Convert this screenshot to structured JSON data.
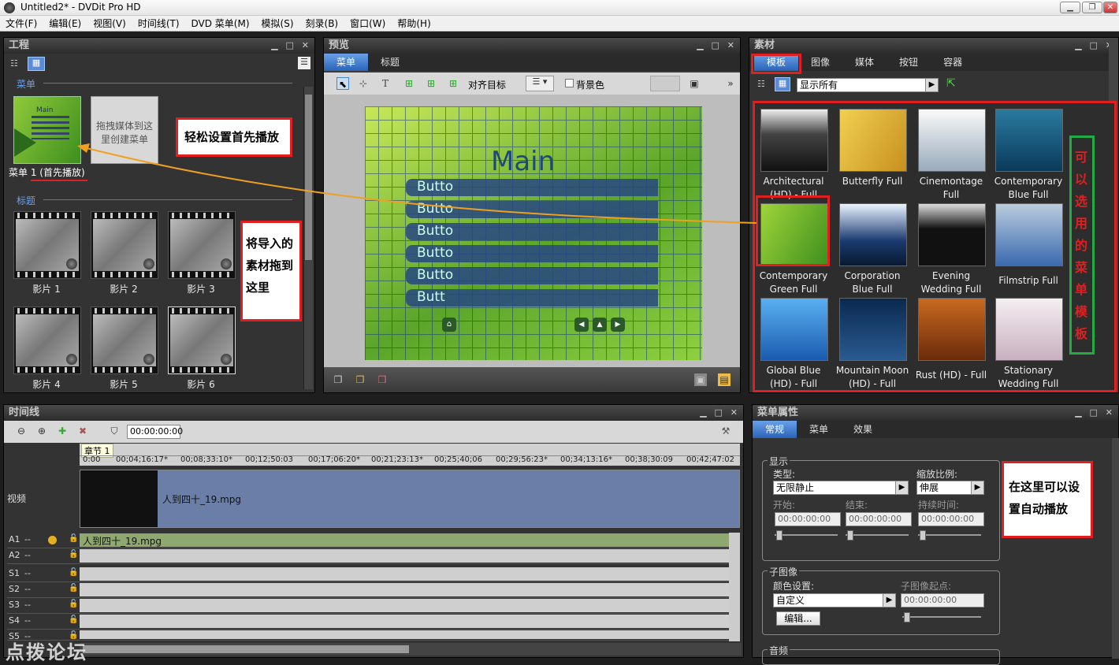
{
  "window": {
    "title": "Untitled2* - DVDit Pro HD",
    "minimize": "▁",
    "restore": "❐",
    "close": "✕"
  },
  "menubar": [
    "文件(F)",
    "编辑(E)",
    "视图(V)",
    "时间线(T)",
    "DVD 菜单(M)",
    "模拟(S)",
    "刻录(B)",
    "窗口(W)",
    "帮助(H)"
  ],
  "project": {
    "title": "工程",
    "menu_section": "菜单",
    "menu_item": "菜单 1 (首先播放)",
    "menu_placeholder": "拖拽媒体到这里创建菜单",
    "titles_section": "标题",
    "films": [
      "影片 1",
      "影片 2",
      "影片 3",
      "影片 4",
      "影片 5",
      "影片 6"
    ],
    "note_firstplay": "轻松设置首先播放",
    "note_drag": "将导入的素材拖到这里"
  },
  "preview": {
    "title": "预览",
    "tabs": [
      "菜单",
      "标题"
    ],
    "align_target": "对齐目标",
    "bg_color": "背景色",
    "menu_title": "Main",
    "buttons": [
      "Butto",
      "Butto",
      "Butto",
      "Butto",
      "Butto",
      "Butt"
    ]
  },
  "assets": {
    "title": "素材",
    "tabs": [
      "模板",
      "图像",
      "媒体",
      "按钮",
      "容器"
    ],
    "filter": "显示所有",
    "templates": [
      "Architectural (HD) - Full",
      "Butterfly Full",
      "Cinemontage Full",
      "Contemporary Blue Full",
      "Contemporary Green Full",
      "Corporation Blue Full",
      "Evening Wedding Full",
      "Filmstrip Full",
      "Global Blue (HD) - Full",
      "Mountain Moon (HD) - Full",
      "Rust (HD) - Full",
      "Stationary Wedding Full"
    ],
    "note_templates": "可以选用的菜单模板",
    "colors": {
      "accent_red": "#e02020",
      "accent_green": "#22aa44"
    }
  },
  "timeline": {
    "title": "时间线",
    "timecode": "00:00:00:00",
    "chapter": "章节 1",
    "ruler": [
      "0:00",
      "00;04;16:17*",
      "00;08;33:10*",
      "00;12;50:03",
      "00;17;06:20*",
      "00;21;23:13*",
      "00;25;40;06",
      "00;29;56:23*",
      "00;34;13:16*",
      "00;38;30:09",
      "00;42;47:02"
    ],
    "video_label": "视频",
    "clip_name": "人到四十_19.mpg",
    "audio_clip": "人到四十_19.mpg",
    "tracks": [
      "A1",
      "A2",
      "S1",
      "S2",
      "S3",
      "S4",
      "S5"
    ],
    "dash": "--",
    "watermark": "点拨论坛"
  },
  "properties": {
    "title": "菜单属性",
    "tabs": [
      "常规",
      "菜单",
      "效果"
    ],
    "display_group": "显示",
    "type_label": "类型:",
    "type_value": "无限静止",
    "scale_label": "缩放比例:",
    "scale_value": "伸展",
    "start_label": "开始:",
    "end_label": "结束:",
    "duration_label": "持续时间:",
    "start_value": "00:00:00:00",
    "end_value": "00:00:00:00",
    "duration_value": "00:00:00:00",
    "subpicture_group": "子图像",
    "color_label": "颜色设置:",
    "color_value": "自定义",
    "subpic_start_label": "子图像起点:",
    "subpic_start_value": "00:00:00:00",
    "edit_button": "编辑...",
    "audio_group": "音频",
    "note_autoplay": "在这里可以设置自动播放"
  }
}
